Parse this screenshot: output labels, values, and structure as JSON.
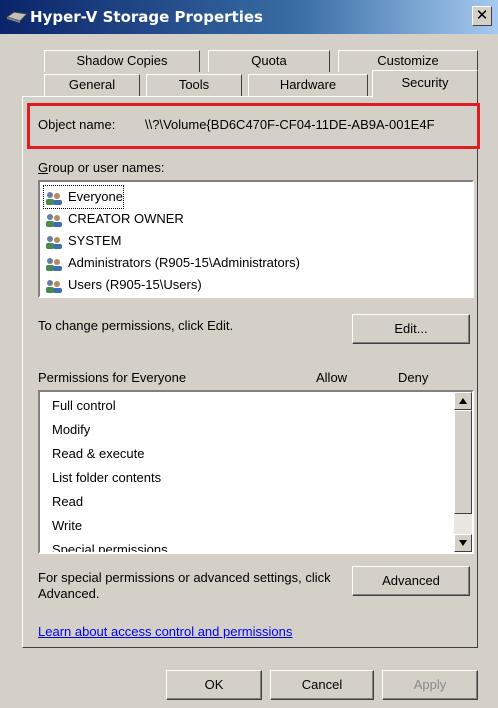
{
  "window": {
    "title": "Hyper-V Storage Properties",
    "close_glyph": "✕"
  },
  "tabs_row1": [
    "Shadow Copies",
    "Quota",
    "Customize"
  ],
  "tabs_row2": [
    "General",
    "Tools",
    "Hardware",
    "Security"
  ],
  "active_tab": "Security",
  "object": {
    "label": "Object name:",
    "value": "\\\\?\\Volume{BD6C470F-CF04-11DE-AB9A-001E4F"
  },
  "groups": {
    "label": "Group or user names:",
    "items": [
      "Everyone",
      "CREATOR OWNER",
      "SYSTEM",
      "Administrators (R905-15\\Administrators)",
      "Users (R905-15\\Users)"
    ],
    "selected_index": 0
  },
  "change_hint": "To change permissions, click Edit.",
  "edit_button": "Edit...",
  "permissions": {
    "label": "Permissions for Everyone",
    "allow_header": "Allow",
    "deny_header": "Deny",
    "rows": [
      "Full control",
      "Modify",
      "Read & execute",
      "List folder contents",
      "Read",
      "Write",
      "Special permissions"
    ]
  },
  "advanced_hint": "For special permissions or advanced settings, click Advanced.",
  "advanced_button": "Advanced",
  "learn_link": "Learn about access control and permissions",
  "footer": {
    "ok": "OK",
    "cancel": "Cancel",
    "apply": "Apply"
  },
  "colors": {
    "highlight_box": "#e01b24",
    "title_bar": "#0a246a",
    "link": "#0000ee"
  },
  "icons": {
    "title": "storage-drive-icon",
    "user": "user-group-icon"
  }
}
